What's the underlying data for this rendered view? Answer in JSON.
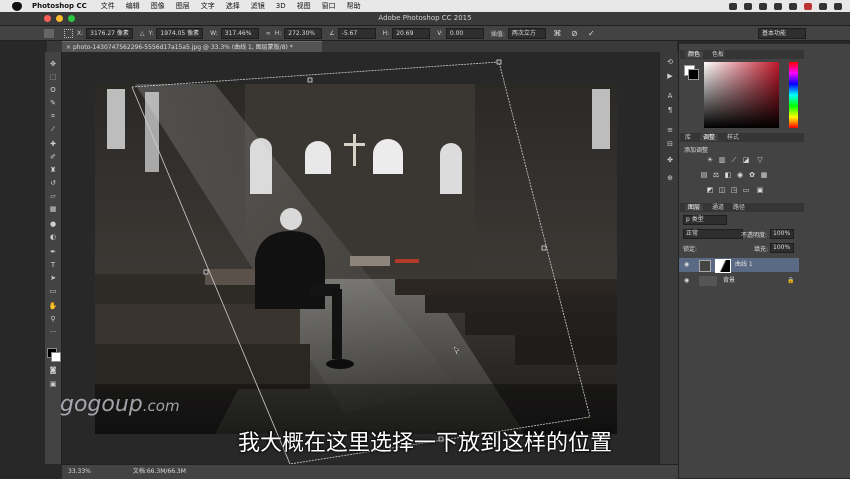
{
  "menubar": {
    "app": "Photoshop CC",
    "items": [
      "文件",
      "编辑",
      "图像",
      "图层",
      "文字",
      "选择",
      "滤镜",
      "3D",
      "视图",
      "窗口",
      "帮助"
    ]
  },
  "window": {
    "title": "Adobe Photoshop CC 2015"
  },
  "options": {
    "x_label": "X:",
    "x_value": "3176.27 像素",
    "y_label": "Y:",
    "y_value": "1974.05 像素",
    "w_label": "W:",
    "w_value": "317.46%",
    "h_label": "H:",
    "h_value": "272.30%",
    "angle_value": "-5.67",
    "hskew_label": "H:",
    "hskew_value": "20.69",
    "vskew_label": "V:",
    "vskew_value": "0.00",
    "interp_label": "插值:",
    "interp_value": "两次立方",
    "workspace": "基本功能"
  },
  "document": {
    "tab_label": "photo-1430747562296-5556d17a15a5.jpg @ 33.3% (曲线 1, 图层蒙版/8) *"
  },
  "status": {
    "zoom": "33.33%",
    "doc_info": "文档:66.3M/66.3M"
  },
  "panels": {
    "color_tabs": [
      "颜色",
      "色板"
    ],
    "adjust_tabs": [
      "库",
      "调整",
      "样式"
    ],
    "adjust_title": "添加调整",
    "layers_tabs": [
      "图层",
      "通道",
      "路径"
    ],
    "blend_mode": "正常",
    "opacity_label": "不透明度:",
    "opacity_value": "100%",
    "lock_label": "锁定:",
    "fill_label": "填充:",
    "fill_value": "100%",
    "layers": [
      {
        "name": "曲线 1"
      },
      {
        "name": "背景"
      }
    ]
  },
  "overlay": {
    "watermark": "gogoup",
    "watermark_suffix": ".com",
    "subtitle": "我大概在这里选择一下放到这样的位置"
  }
}
